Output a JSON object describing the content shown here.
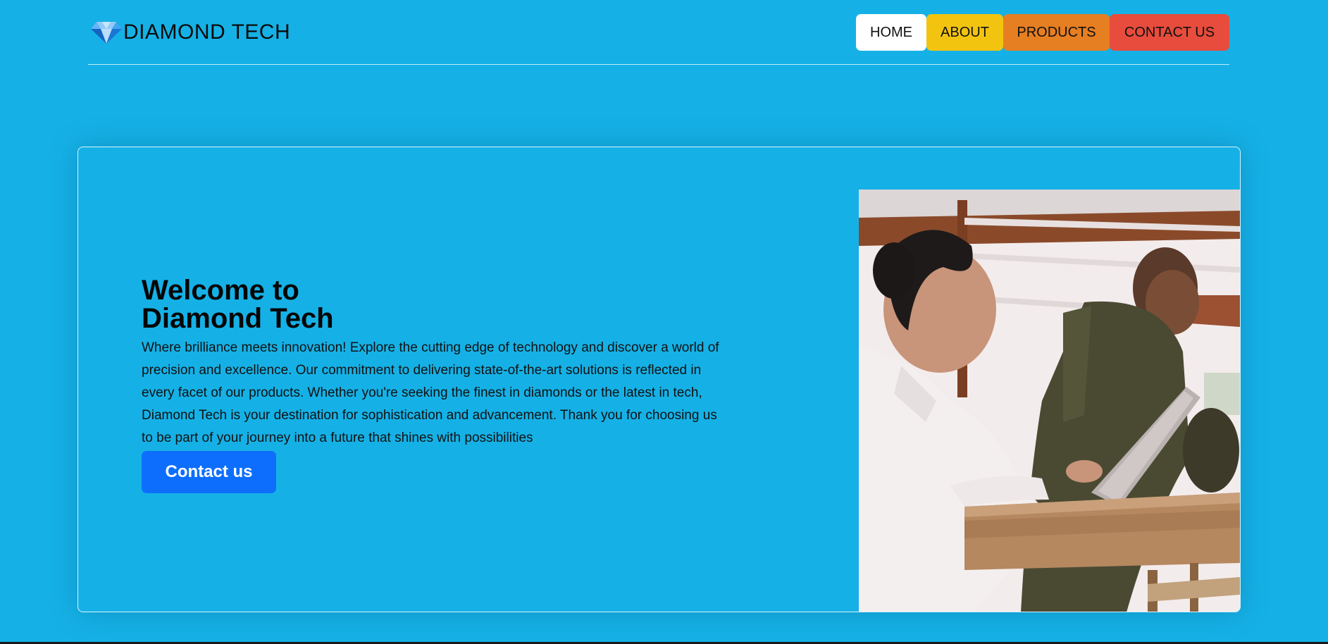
{
  "header": {
    "brand_icon": "diamond-icon",
    "brand_name": "DIAMOND TECH",
    "nav": [
      {
        "label": "HOME",
        "color": "#ffffff"
      },
      {
        "label": "ABOUT",
        "color": "#f2c40f"
      },
      {
        "label": "PRODUCTS",
        "color": "#e67e22"
      },
      {
        "label": "CONTACT US",
        "color": "#e74c3c"
      }
    ]
  },
  "hero": {
    "title_line1": "Welcome to",
    "title_line2": "Diamond Tech",
    "body": "Where brilliance meets innovation! Explore the cutting edge of technology and discover a world of precision and excellence. Our commitment to delivering state-of-the-art solutions is reflected in every facet of our products. Whether you're seeking the finest in diamonds or the latest in tech, Diamond Tech is your destination for sophistication and advancement. Thank you for choosing us to be part of your journey into a future that shines with possibilities",
    "cta_label": "Contact us",
    "cta_color": "#0d6efd",
    "photo": "two-women-working-on-laptop-photo"
  },
  "theme": {
    "background": "#15b1e6"
  }
}
